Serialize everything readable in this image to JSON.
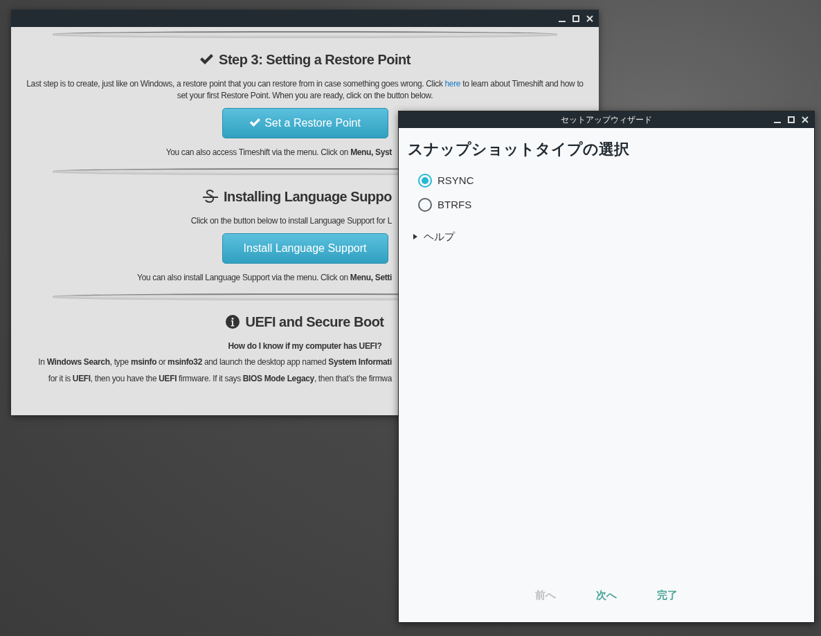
{
  "back_window": {
    "sections": [
      {
        "kind": "check",
        "heading": "Step 3: Setting a Restore Point",
        "heading_covered": false,
        "paragraphs": [
          {
            "kind": "link",
            "before": "Last step is to create, just like on Windows, a restore point that you can restore from in case something goes wrong. Click ",
            "link": "here",
            "after": " to learn about Timeshift and how to set your first Restore Point. When you are ready, click on the button below.",
            "covered": false,
            "bold": false
          }
        ],
        "button": {
          "label": "Set a Restore Point",
          "icon": true
        },
        "notes": [
          {
            "text": "You can also access Timeshift via the menu. Click on **Menu, Syst**",
            "covered": true
          }
        ]
      },
      {
        "kind": "strike",
        "heading": "Installing Language Suppo",
        "heading_covered": true,
        "paragraphs": [
          {
            "kind": "plain",
            "text": "Click on the button below to install Language Support for L",
            "covered": true,
            "bold": false
          }
        ],
        "button": {
          "label": "Install Language Support",
          "icon": false
        },
        "notes": [
          {
            "text": "You can also install Language Support via the menu. Click on **Menu, Setti**",
            "covered": true
          }
        ]
      },
      {
        "kind": "info",
        "heading": "UEFI and Secure Boot",
        "heading_covered": false,
        "paragraphs": [
          {
            "kind": "plain",
            "text": "How do I know if my computer has UEFI?",
            "covered": false,
            "bold": true
          },
          {
            "kind": "plain",
            "text": "In **Windows Search**, type **msinfo** or **msinfo32** and launch the desktop app named **System Informati**",
            "covered": true,
            "bold": false
          },
          {
            "kind": "plain",
            "text": "for it is **UEFI**, then you have the **UEFI** firmware. If it says **BIOS Mode Legacy**, then that’s the firmwa",
            "covered": true,
            "bold": false
          }
        ]
      }
    ]
  },
  "wizard": {
    "title": "セットアップウィザード",
    "heading": "スナップショットタイプの選択",
    "options": [
      {
        "label": "RSYNC",
        "selected": true
      },
      {
        "label": "BTRFS",
        "selected": false
      }
    ],
    "expander": {
      "label": "ヘルプ",
      "expanded": false
    },
    "buttons": [
      {
        "label": "前へ",
        "disabled": true
      },
      {
        "label": "次へ",
        "disabled": false
      },
      {
        "label": "完了",
        "disabled": false
      }
    ]
  }
}
